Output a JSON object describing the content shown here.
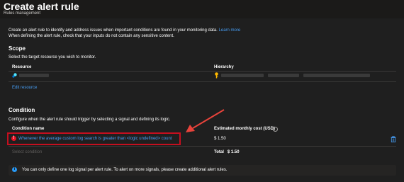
{
  "header": {
    "title": "Create alert rule",
    "subtitle": "Rules management"
  },
  "intro": {
    "line1": "Create an alert rule to identify and address issues when important conditions are found in your monitoring data.",
    "learn_more": "Learn more",
    "line2": "When defining the alert rule, check that your inputs do not contain any sensitive content."
  },
  "scope": {
    "heading": "Scope",
    "description": "Select the target resource you wish to monitor.",
    "col_resource": "Resource",
    "col_hierarchy": "Hierarchy",
    "edit_resource": "Edit resource"
  },
  "condition": {
    "heading": "Condition",
    "description": "Configure when the alert rule should trigger by selecting a signal and defining its logic.",
    "col_name": "Condition name",
    "col_cost": "Estimated monthly cost (USD)",
    "row_text": "Whenever the average custom log search is greater than <logic undefined> count",
    "row_cost": "$ 1.50",
    "select_condition": "Select condition",
    "total_label": "Total",
    "total_value": "$ 1.50"
  },
  "banner": {
    "text": "You can only define one log signal per alert rule. To alert on more signals, please create additional alert rules."
  },
  "icons": {
    "resource": "resource-icon",
    "hierarchy": "key-icon",
    "info": "info-icon",
    "error": "error-icon",
    "delete": "trash-icon",
    "banner": "info-icon"
  },
  "colors": {
    "background": "#1f1f1f",
    "link": "#479ef5",
    "highlight": "#c50f1f",
    "arrow": "#e8433b",
    "error": "#e81123"
  }
}
